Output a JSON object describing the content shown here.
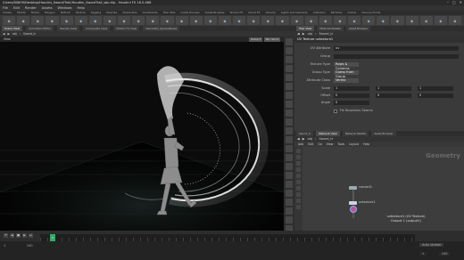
{
  "window": {
    "title": "/Users/80809/Desktop/Houdini_Sword/Trail/Houdini_SwordTrail_wip.hip - Houdini FX 16.0.468",
    "controls": [
      "–",
      "□",
      "✕"
    ]
  },
  "menu": [
    "File",
    "Edit",
    "Render",
    "Assets",
    "Windows",
    "Help"
  ],
  "shelf_tabs": [
    "Create",
    "Modify",
    "Model",
    "Polygon",
    "Deform",
    "Texture",
    "Rigging",
    "Muscles",
    "Characters",
    "Constraints",
    "Hair Utils",
    "Guide Process",
    "Guide Brushes",
    "Terrain FX",
    "Cloud FX",
    "Volume",
    "Lights and Cameras",
    "Collisions",
    "Particles",
    "Grains",
    "Viscous Fluids"
  ],
  "shelf_tools": 32,
  "left": {
    "tabs": [
      "Scene View",
      "Animation Editor",
      "Render View",
      "Composite View",
      "Motion FX View",
      "Geometry Spreadsheet"
    ],
    "path": [
      "obj",
      "Sword_tr"
    ],
    "viewport_label": "View",
    "camera_btns": [
      "Persp ▾",
      "No cam ▾"
    ]
  },
  "params": {
    "tabs": [
      "Tree View",
      "Material Palette",
      "Asset Browser"
    ],
    "path": [
      "obj",
      "Sword_tr"
    ],
    "node_title": "UV Texture  uvtexture1",
    "rows": [
      {
        "label": "UV Attribute",
        "value": "uv",
        "kind": "text"
      },
      {
        "label": "Group",
        "value": "",
        "kind": "text"
      },
      {
        "label": "Texture Type",
        "value": "Rows & Columns",
        "kind": "drop"
      },
      {
        "label": "Group Type",
        "value": "Guess from Group",
        "kind": "drop"
      },
      {
        "label": "Attribute Class",
        "value": "Vertex",
        "kind": "drop"
      }
    ],
    "scale": {
      "label": "Scale",
      "values": [
        "1",
        "1",
        "1"
      ]
    },
    "offset": {
      "label": "Offset",
      "values": [
        "0",
        "0",
        "0"
      ]
    },
    "angle": {
      "label": "Angle",
      "values": [
        "0"
      ]
    },
    "checkbox": "Fix Boundary Seams"
  },
  "network": {
    "tabs": [
      "Sword_tr",
      "Network View",
      "Material Palette",
      "Asset Browser"
    ],
    "path": [
      "obj",
      "Sword_tr"
    ],
    "menu": [
      "Add",
      "Edit",
      "Go",
      "View",
      "Tools",
      "Layout",
      "Help"
    ],
    "context_label": "Geometry",
    "nodes": [
      {
        "name": "convert1",
        "color": "#9ab0c0"
      },
      {
        "name": "uvtexture1",
        "color": "#c0c8d0"
      }
    ],
    "info_line1": "uvtexture1 (UV Texture)",
    "info_line2": "Output 1 (output1)"
  },
  "timeline": {
    "frame": "1",
    "start": "1",
    "end": "240",
    "status": "Auto Update",
    "frame_field": "1",
    "end_field": "240"
  }
}
